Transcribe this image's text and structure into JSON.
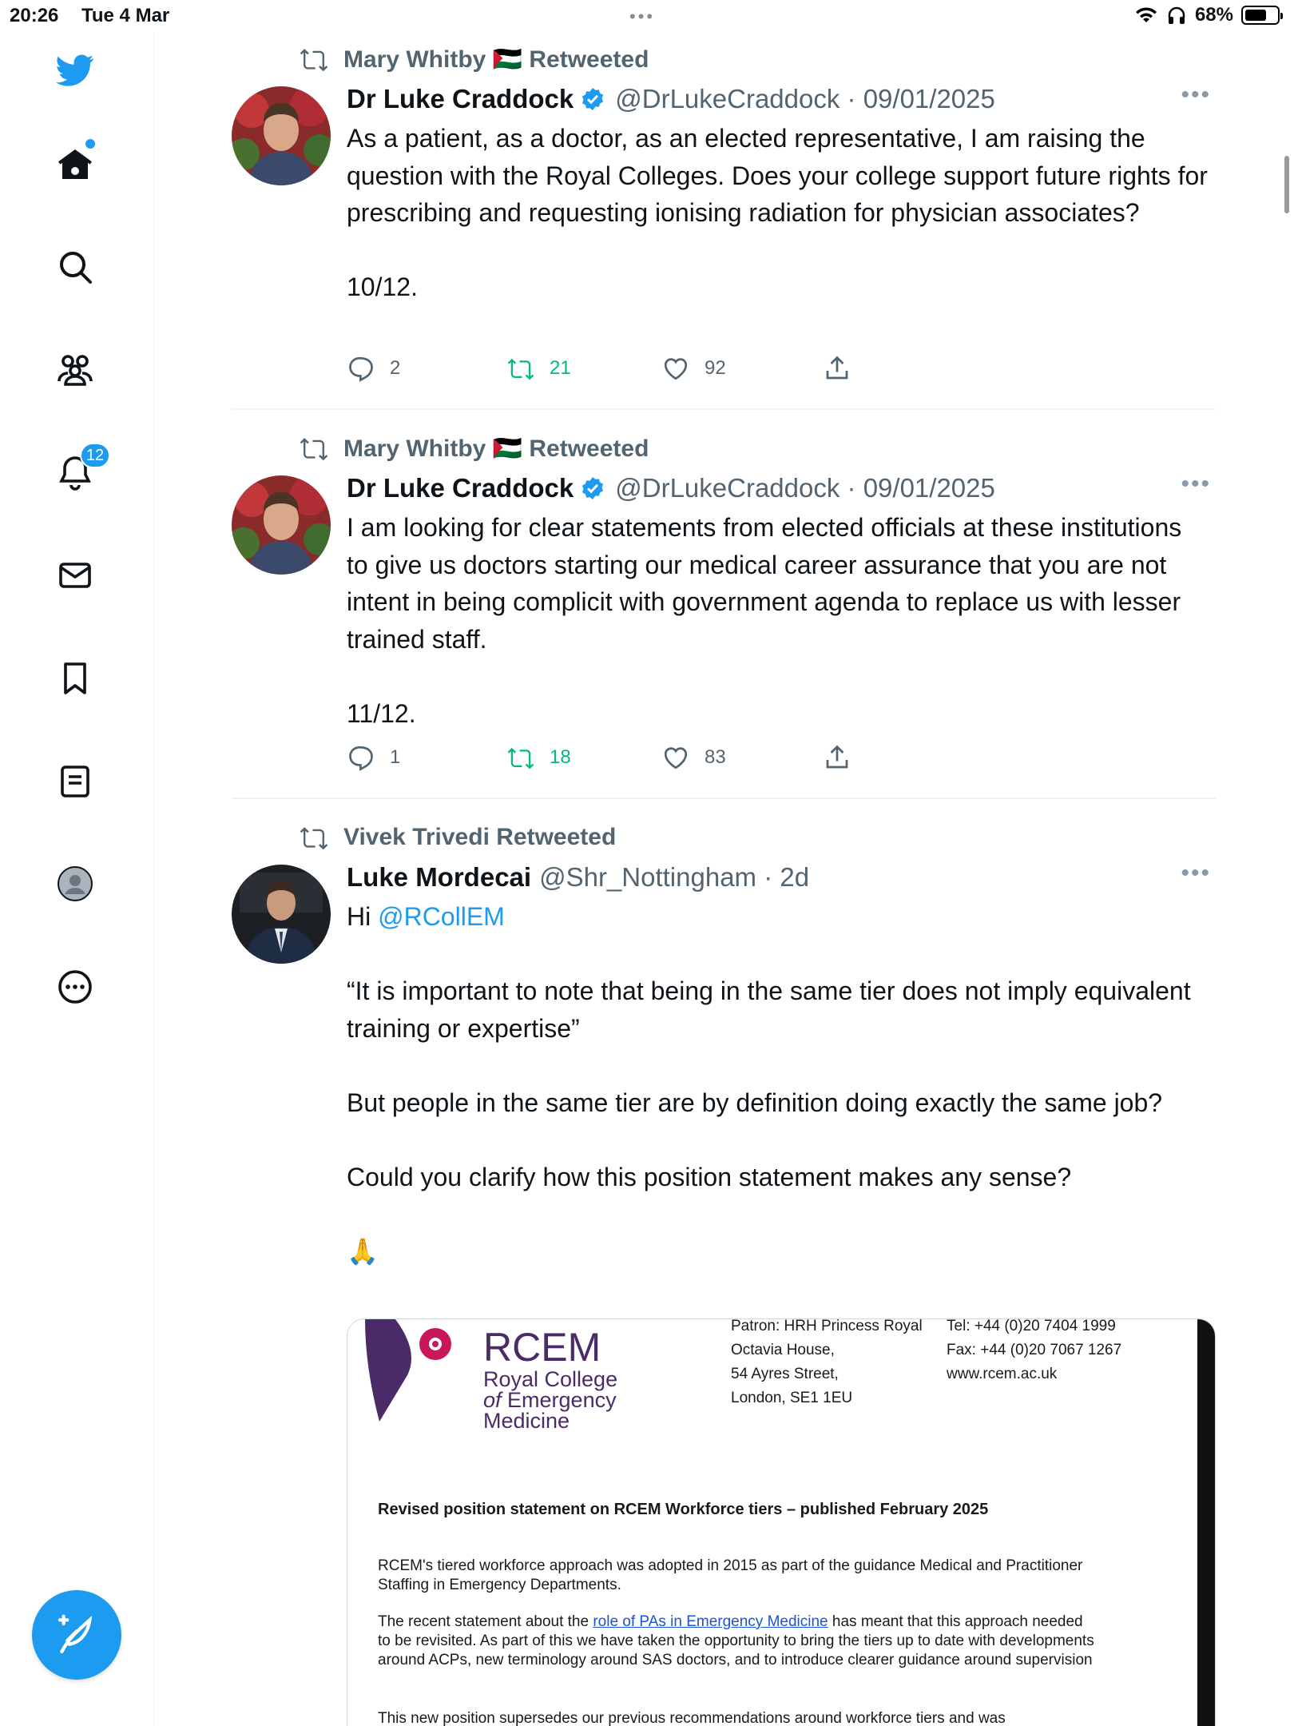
{
  "status_bar": {
    "time": "20:26",
    "date": "Tue 4 Mar",
    "battery": "68%",
    "battery_level": 0.68
  },
  "nav": {
    "notifications_badge": "12"
  },
  "colors": {
    "accent": "#1d9bf0",
    "retweet_green": "#00ba7c",
    "muted": "#536471"
  },
  "tweets": [
    {
      "retweeted_by": "Mary Whitby 🇵🇸 Retweeted",
      "name": "Dr Luke Craddock",
      "handle_date": "@DrLukeCraddock · 09/01/2025",
      "body": "As a patient, as a doctor, as an elected representative, I am raising the question with the Royal Colleges. Does your college support future rights for prescribing and requesting ionising radiation for physician associates?\n\n10/12.",
      "replies": "2",
      "retweets": "21",
      "likes": "92"
    },
    {
      "retweeted_by": "Mary Whitby 🇵🇸 Retweeted",
      "name": "Dr Luke Craddock",
      "handle_date": "@DrLukeCraddock · 09/01/2025",
      "body": "I am looking for clear statements from elected officials at these institutions to give us doctors starting our medical career assurance that you are not intent in being complicit with government agenda to replace us with lesser trained staff.\n\n11/12.",
      "replies": "1",
      "retweets": "18",
      "likes": "83"
    },
    {
      "retweeted_by": "Vivek Trivedi Retweeted",
      "name": "Luke Mordecai",
      "handle_date": "@Shr_Nottingham · 2d",
      "body_prefix": "Hi ",
      "mention": "@RCollEM",
      "body": "\n\n“It is important to note that being in the same tier does not imply equivalent training or expertise”\n\nBut people in the same tier are by definition doing exactly the same job?\n\nCould you clarify how this position statement makes any sense?\n\n🙏"
    }
  ],
  "document": {
    "logo_name": "RCEM",
    "logo_sub_line1": "Royal College",
    "logo_sub_line2_prefix": "of",
    "logo_sub_line2": " Emergency",
    "logo_sub_line3": "Medicine",
    "address_lines": [
      "Patron: HRH Princess Royal",
      "Octavia House,",
      "54 Ayres Street,",
      "London, SE1 1EU"
    ],
    "contact_lines": [
      "Tel:   +44 (0)20 7404 1999",
      "Fax: +44 (0)20 7067 1267",
      "www.rcem.ac.uk"
    ],
    "heading": "Revised position statement on RCEM Workforce tiers – published February 2025",
    "para1": "RCEM's tiered workforce approach was adopted in 2015 as part of the guidance Medical and Practitioner Staffing in Emergency Departments.",
    "para2_prefix": "The recent statement about the ",
    "para2_link": "role of PAs in Emergency Medicine",
    "para2_rest": " has meant that this approach needed to be revisited. As part of this we have taken the opportunity to bring the tiers up to date with developments around ACPs, new terminology around SAS doctors, and to introduce clearer guidance around supervision",
    "para3": "This new position supersedes our previous recommendations around workforce tiers and was"
  }
}
